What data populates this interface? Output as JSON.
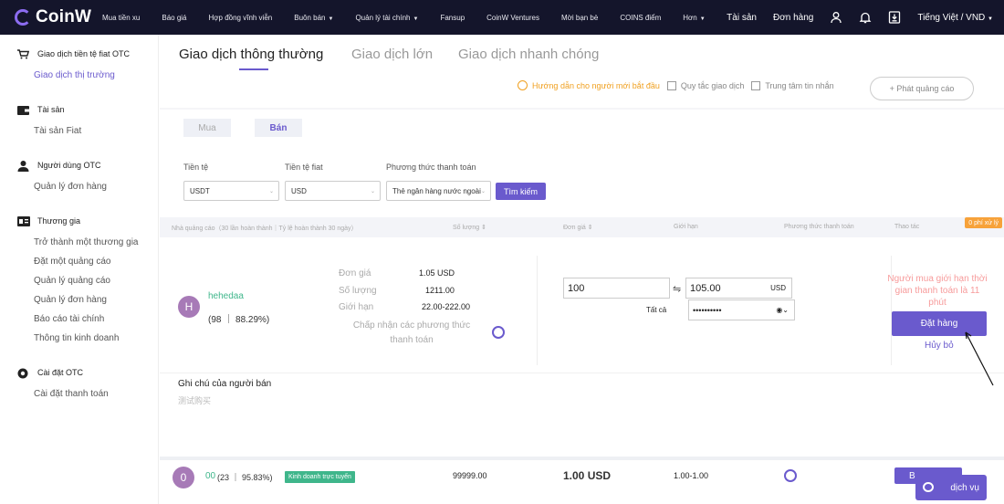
{
  "brand": {
    "name": "CoinW",
    "accent": "#6a5acd",
    "nav_bg": "#14152b",
    "green": "#3fb68b",
    "orange": "#f0a020"
  },
  "topnav": {
    "items": [
      {
        "label": "Mua tiền xu"
      },
      {
        "label": "Báo giá"
      },
      {
        "label": "Hợp đồng vĩnh viễn"
      },
      {
        "label": "Buôn bán",
        "caret": "▼"
      },
      {
        "label": "Quản lý tài chính",
        "caret": "▼"
      },
      {
        "label": "Fansup"
      },
      {
        "label": "CoinW Ventures"
      },
      {
        "label": "Mời bạn bè"
      },
      {
        "label": "COINS điểm"
      },
      {
        "label": "Hơn",
        "caret": "▼"
      }
    ],
    "assets": "Tài sản",
    "orders": "Đơn hàng",
    "icons": [
      "user-icon",
      "bell-icon",
      "download-icon"
    ],
    "language": "Tiếng Việt / VND",
    "language_caret": "▼"
  },
  "sidebar": {
    "groups": [
      {
        "title": "Giao dịch tiền tệ fiat OTC",
        "icon": "cart-icon",
        "links": [
          {
            "label": "Giao dịch thị trường",
            "active": true
          }
        ]
      },
      {
        "title": "Tài sản",
        "icon": "wallet-icon",
        "links": [
          {
            "label": "Tài sản Fiat"
          }
        ]
      },
      {
        "title": "Người dùng OTC",
        "icon": "person-icon",
        "links": [
          {
            "label": "Quản lý đơn hàng"
          }
        ]
      },
      {
        "title": "Thương gia",
        "icon": "merchant-icon",
        "links": [
          {
            "label": "Trở thành một thương gia"
          },
          {
            "label": "Đặt một quảng cáo"
          },
          {
            "label": "Quản lý quảng cáo"
          },
          {
            "label": "Quản lý đơn hàng"
          },
          {
            "label": "Báo cáo tài chính"
          },
          {
            "label": "Thông tin kinh doanh"
          }
        ]
      },
      {
        "title": "Cài đặt OTC",
        "icon": "settings-icon",
        "links": [
          {
            "label": "Cài đặt thanh toán"
          }
        ]
      }
    ]
  },
  "tabs": [
    "Giao dịch thông thường",
    "Giao dịch lớn",
    "Giao dịch nhanh chóng"
  ],
  "help": {
    "guide": "Hướng dẫn cho người mới bắt đầu",
    "rules": "Quy tắc giao dịch",
    "messages": "Trung tâm tin nhắn",
    "post_ad": "+ Phát quảng cáo"
  },
  "trade_side": {
    "buy": "Mua",
    "sell": "Bán"
  },
  "filters": {
    "currency_label": "Tiền tệ",
    "currency_value": "USDT",
    "fiat_label": "Tiền tệ fiat",
    "fiat_value": "USD",
    "payment_label": "Phương thức thanh toán",
    "payment_value": "Thẻ ngân hàng nước ngoài",
    "search": "Tìm kiếm"
  },
  "table_header": {
    "advertiser": "Nhà quảng cáo（30 lần hoàn thành｜Tỷ lệ hoàn thành 30 ngày）",
    "amount": "Số lượng",
    "price": "Đơn giá",
    "limit": "Giới hạn",
    "payment": "Phương thức thanh toán",
    "action": "Thao tác",
    "fee_badge": "0 phí xử lý"
  },
  "expanded_order": {
    "avatar_letter": "H",
    "username": "hehedaa",
    "stats": "(98 ｜ 88.29%)",
    "price_label": "Đơn giá",
    "price_value": "1.05 USD",
    "qty_label": "Số lượng",
    "qty_value": "1211.00",
    "limit_label": "Giới hạn",
    "limit_value": "22.00-222.00",
    "accept_label": "Chấp nhận các phương thức thanh toán",
    "amount_input": "100",
    "swap_symbol": "⇋",
    "total_input": "105.00",
    "total_unit": "USD",
    "all_label": "Tất cả",
    "password_mask": "••••••••••",
    "eye_icon": "eye-icon",
    "buyer_limit_note": "Người mua giới hạn thời gian thanh toán là 11 phút",
    "place_order": "Đặt hàng",
    "cancel": "Hủy bỏ",
    "remark_title": "Ghi chú của người bán",
    "remark_text": "测试购买"
  },
  "row2": {
    "avatar_letter": "0",
    "username": "00",
    "stats": "(23 ｜ 95.83%)",
    "tag": "Kinh doanh trực tuyến",
    "amount": "99999.00",
    "price": "1.00 USD",
    "limit": "1.00-1.00",
    "action_partial": "B",
    "chat": "dịch vụ"
  }
}
